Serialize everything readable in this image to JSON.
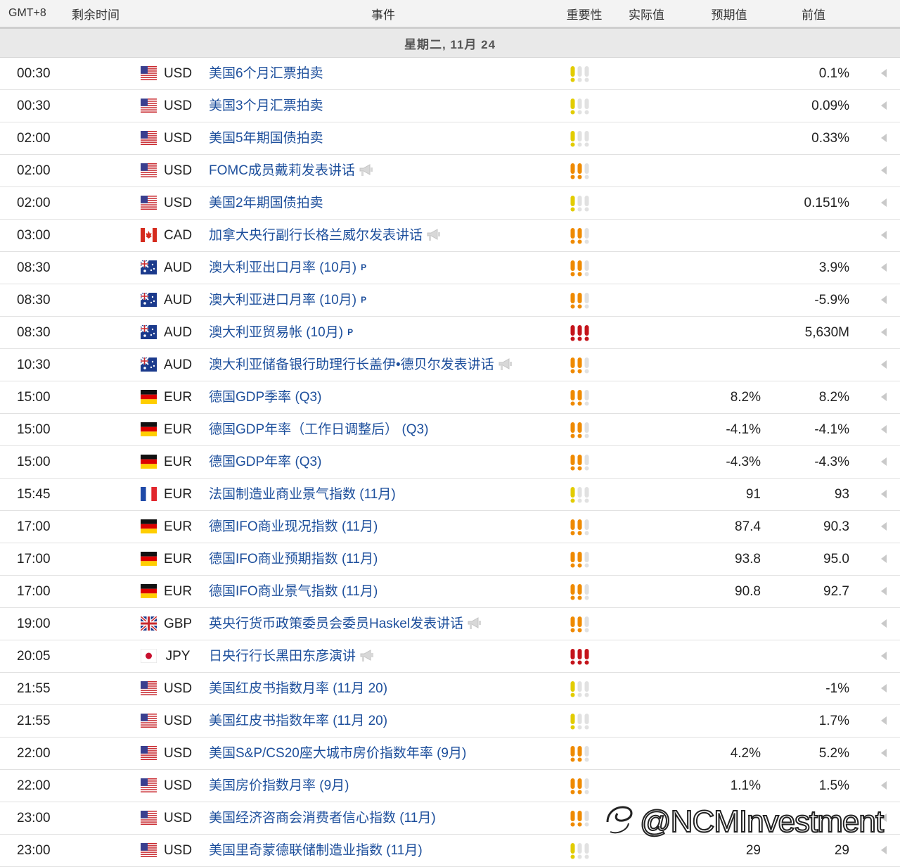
{
  "header": {
    "timezone": "GMT+8",
    "remaining": "剩余时间",
    "event": "事件",
    "importance": "重要性",
    "actual": "实际值",
    "forecast": "预期值",
    "previous": "前值"
  },
  "day_label": "星期二, 11月 24",
  "colors": {
    "link": "#1d4f9c",
    "importance_low": "#e2cc00",
    "importance_medium": "#ef8a00",
    "importance_high": "#c4141b",
    "importance_inactive": "#e1e1e1"
  },
  "rows": [
    {
      "time": "00:30",
      "flag": "us",
      "currency": "USD",
      "event": "美国6个月汇票拍卖",
      "badge": "",
      "speech": false,
      "importance": 1,
      "importance_color": "yellow",
      "actual": "",
      "forecast": "",
      "previous": "0.1%"
    },
    {
      "time": "00:30",
      "flag": "us",
      "currency": "USD",
      "event": "美国3个月汇票拍卖",
      "badge": "",
      "speech": false,
      "importance": 1,
      "importance_color": "yellow",
      "actual": "",
      "forecast": "",
      "previous": "0.09%"
    },
    {
      "time": "02:00",
      "flag": "us",
      "currency": "USD",
      "event": "美国5年期国债拍卖",
      "badge": "",
      "speech": false,
      "importance": 1,
      "importance_color": "yellow",
      "actual": "",
      "forecast": "",
      "previous": "0.33%"
    },
    {
      "time": "02:00",
      "flag": "us",
      "currency": "USD",
      "event": "FOMC成员戴莉发表讲话",
      "badge": "",
      "speech": true,
      "importance": 2,
      "importance_color": "orange",
      "actual": "",
      "forecast": "",
      "previous": ""
    },
    {
      "time": "02:00",
      "flag": "us",
      "currency": "USD",
      "event": "美国2年期国债拍卖",
      "badge": "",
      "speech": false,
      "importance": 1,
      "importance_color": "yellow",
      "actual": "",
      "forecast": "",
      "previous": "0.151%"
    },
    {
      "time": "03:00",
      "flag": "ca",
      "currency": "CAD",
      "event": "加拿大央行副行长格兰威尔发表讲话",
      "badge": "",
      "speech": true,
      "importance": 2,
      "importance_color": "orange",
      "actual": "",
      "forecast": "",
      "previous": ""
    },
    {
      "time": "08:30",
      "flag": "au",
      "currency": "AUD",
      "event": "澳大利亚出口月率 (10月)",
      "badge": "P",
      "speech": false,
      "importance": 2,
      "importance_color": "orange",
      "actual": "",
      "forecast": "",
      "previous": "3.9%"
    },
    {
      "time": "08:30",
      "flag": "au",
      "currency": "AUD",
      "event": "澳大利亚进口月率 (10月)",
      "badge": "P",
      "speech": false,
      "importance": 2,
      "importance_color": "orange",
      "actual": "",
      "forecast": "",
      "previous": "-5.9%"
    },
    {
      "time": "08:30",
      "flag": "au",
      "currency": "AUD",
      "event": "澳大利亚贸易帐 (10月)",
      "badge": "P",
      "speech": false,
      "importance": 3,
      "importance_color": "red",
      "actual": "",
      "forecast": "",
      "previous": "5,630M"
    },
    {
      "time": "10:30",
      "flag": "au",
      "currency": "AUD",
      "event": "澳大利亚储备银行助理行长盖伊•德贝尔发表讲话",
      "badge": "",
      "speech": true,
      "importance": 2,
      "importance_color": "orange",
      "actual": "",
      "forecast": "",
      "previous": ""
    },
    {
      "time": "15:00",
      "flag": "de",
      "currency": "EUR",
      "event": "德国GDP季率 (Q3)",
      "badge": "",
      "speech": false,
      "importance": 2,
      "importance_color": "orange",
      "actual": "",
      "forecast": "8.2%",
      "previous": "8.2%"
    },
    {
      "time": "15:00",
      "flag": "de",
      "currency": "EUR",
      "event": "德国GDP年率（工作日调整后） (Q3)",
      "badge": "",
      "speech": false,
      "importance": 2,
      "importance_color": "orange",
      "actual": "",
      "forecast": "-4.1%",
      "previous": "-4.1%"
    },
    {
      "time": "15:00",
      "flag": "de",
      "currency": "EUR",
      "event": "德国GDP年率 (Q3)",
      "badge": "",
      "speech": false,
      "importance": 2,
      "importance_color": "orange",
      "actual": "",
      "forecast": "-4.3%",
      "previous": "-4.3%"
    },
    {
      "time": "15:45",
      "flag": "fr",
      "currency": "EUR",
      "event": "法国制造业商业景气指数 (11月)",
      "badge": "",
      "speech": false,
      "importance": 1,
      "importance_color": "yellow",
      "actual": "",
      "forecast": "91",
      "previous": "93"
    },
    {
      "time": "17:00",
      "flag": "de",
      "currency": "EUR",
      "event": "德国IFO商业现况指数 (11月)",
      "badge": "",
      "speech": false,
      "importance": 2,
      "importance_color": "orange",
      "actual": "",
      "forecast": "87.4",
      "previous": "90.3"
    },
    {
      "time": "17:00",
      "flag": "de",
      "currency": "EUR",
      "event": "德国IFO商业预期指数 (11月)",
      "badge": "",
      "speech": false,
      "importance": 2,
      "importance_color": "orange",
      "actual": "",
      "forecast": "93.8",
      "previous": "95.0"
    },
    {
      "time": "17:00",
      "flag": "de",
      "currency": "EUR",
      "event": "德国IFO商业景气指数 (11月)",
      "badge": "",
      "speech": false,
      "importance": 2,
      "importance_color": "orange",
      "actual": "",
      "forecast": "90.8",
      "previous": "92.7"
    },
    {
      "time": "19:00",
      "flag": "gb",
      "currency": "GBP",
      "event": "英央行货币政策委员会委员Haskel发表讲话",
      "badge": "",
      "speech": true,
      "importance": 2,
      "importance_color": "orange",
      "actual": "",
      "forecast": "",
      "previous": ""
    },
    {
      "time": "20:05",
      "flag": "jp",
      "currency": "JPY",
      "event": "日央行行长黑田东彦演讲",
      "badge": "",
      "speech": true,
      "importance": 3,
      "importance_color": "red",
      "actual": "",
      "forecast": "",
      "previous": ""
    },
    {
      "time": "21:55",
      "flag": "us",
      "currency": "USD",
      "event": "美国红皮书指数月率 (11月 20)",
      "badge": "",
      "speech": false,
      "importance": 1,
      "importance_color": "yellow",
      "actual": "",
      "forecast": "",
      "previous": "-1%"
    },
    {
      "time": "21:55",
      "flag": "us",
      "currency": "USD",
      "event": "美国红皮书指数年率 (11月 20)",
      "badge": "",
      "speech": false,
      "importance": 1,
      "importance_color": "yellow",
      "actual": "",
      "forecast": "",
      "previous": "1.7%"
    },
    {
      "time": "22:00",
      "flag": "us",
      "currency": "USD",
      "event": "美国S&P/CS20座大城市房价指数年率 (9月)",
      "badge": "",
      "speech": false,
      "importance": 2,
      "importance_color": "orange",
      "actual": "",
      "forecast": "4.2%",
      "previous": "5.2%"
    },
    {
      "time": "22:00",
      "flag": "us",
      "currency": "USD",
      "event": "美国房价指数月率 (9月)",
      "badge": "",
      "speech": false,
      "importance": 2,
      "importance_color": "orange",
      "actual": "",
      "forecast": "1.1%",
      "previous": "1.5%"
    },
    {
      "time": "23:00",
      "flag": "us",
      "currency": "USD",
      "event": "美国经济咨商会消费者信心指数 (11月)",
      "badge": "",
      "speech": false,
      "importance": 2,
      "importance_color": "orange",
      "actual": "",
      "forecast": "",
      "previous": ""
    },
    {
      "time": "23:00",
      "flag": "us",
      "currency": "USD",
      "event": "美国里奇蒙德联储制造业指数 (11月)",
      "badge": "",
      "speech": false,
      "importance": 1,
      "importance_color": "yellow",
      "actual": "",
      "forecast": "29",
      "previous": "29"
    }
  ],
  "watermark": "@NCMInvestment"
}
